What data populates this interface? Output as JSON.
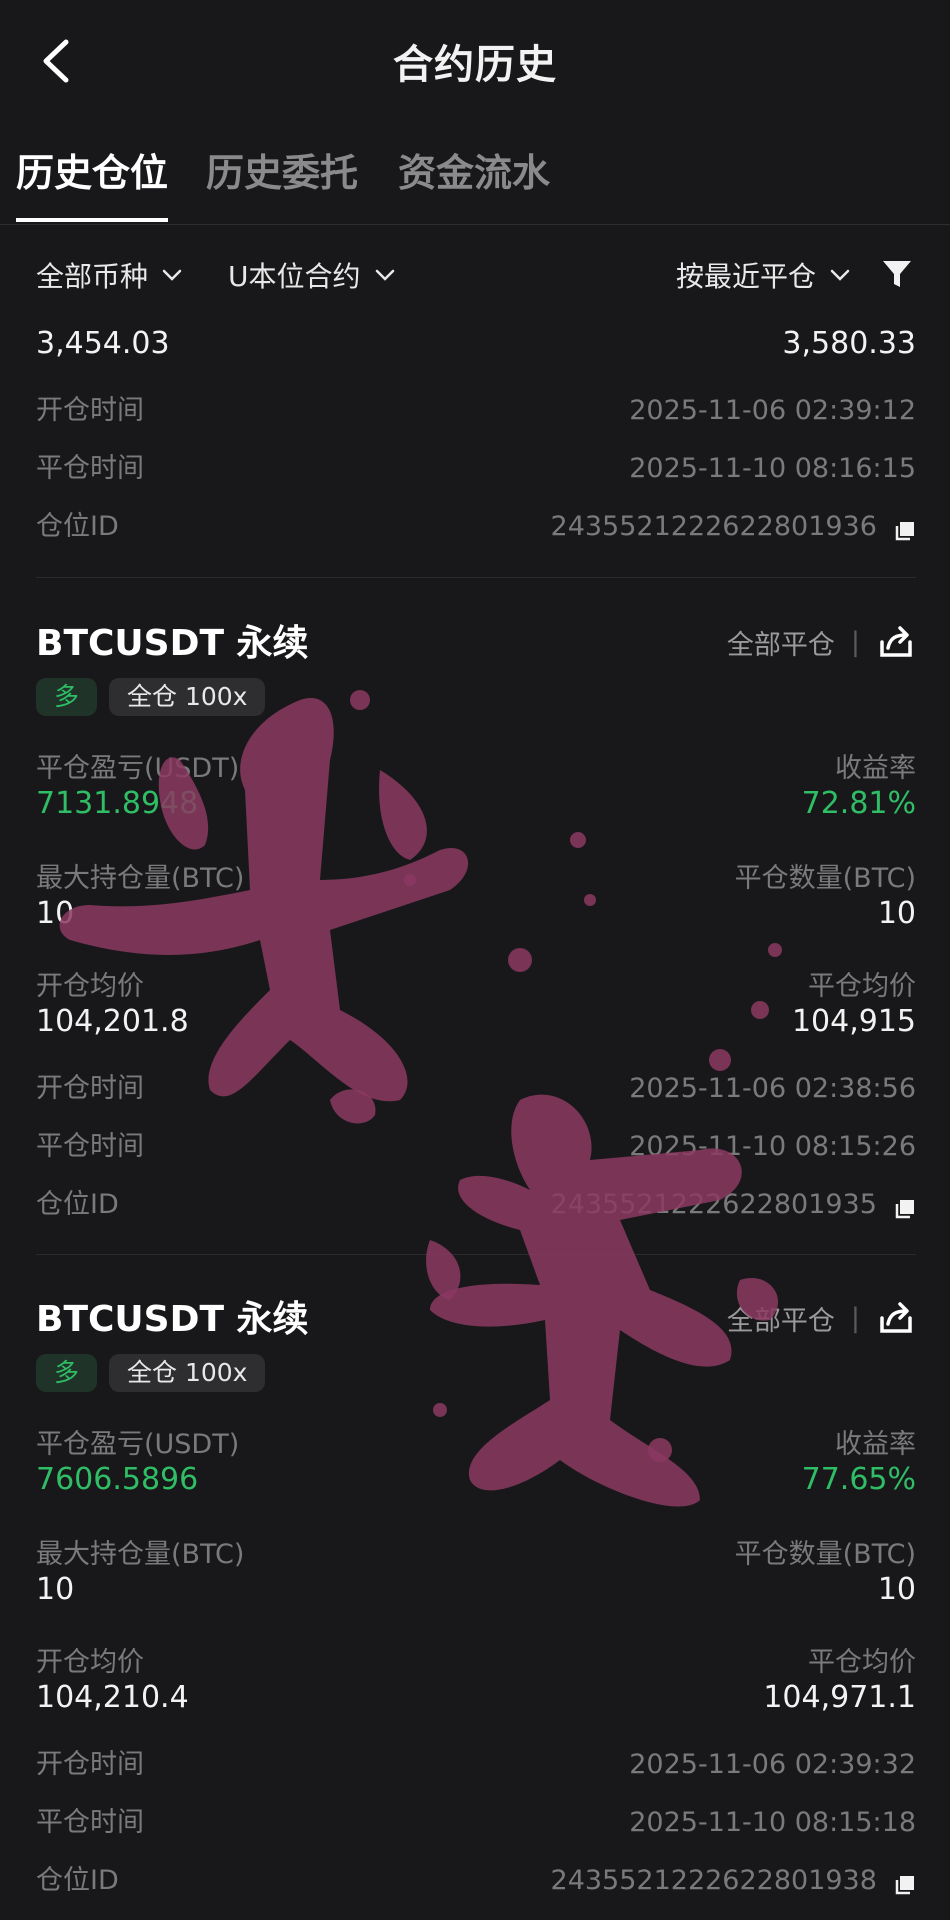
{
  "header": {
    "title": "合约历史",
    "back_icon": "chevron-left-icon"
  },
  "tabs": [
    {
      "label": "历史仓位",
      "active": true
    },
    {
      "label": "历史委托",
      "active": false
    },
    {
      "label": "资金流水",
      "active": false
    }
  ],
  "filters": {
    "coin": "全部币种",
    "contract_type": "U本位合约",
    "sort": "按最近平仓",
    "filter_icon": "funnel-icon"
  },
  "partial_card": {
    "open_avg_price": "3,454.03",
    "close_avg_price": "3,580.33",
    "open_time_label": "开仓时间",
    "open_time": "2025-11-06 02:39:12",
    "close_time_label": "平仓时间",
    "close_time": "2025-11-10 08:16:15",
    "position_id_label": "仓位ID",
    "position_id": "2435521222622801936"
  },
  "cards": [
    {
      "symbol": "BTCUSDT 永续",
      "action_label": "全部平仓",
      "side_tag": "多",
      "margin_tag": "全仓 100x",
      "pnl_label": "平仓盈亏(USDT)",
      "pnl": "7131.8948",
      "roi_label": "收益率",
      "roi": "72.81%",
      "max_pos_label": "最大持仓量(BTC)",
      "max_pos": "10",
      "close_qty_label": "平仓数量(BTC)",
      "close_qty": "10",
      "open_avg_label": "开仓均价",
      "open_avg": "104,201.8",
      "close_avg_label": "平仓均价",
      "close_avg": "104,915",
      "open_time_label": "开仓时间",
      "open_time": "2025-11-06 02:38:56",
      "close_time_label": "平仓时间",
      "close_time": "2025-11-10 08:15:26",
      "position_id_label": "仓位ID",
      "position_id": "2435521222622801935"
    },
    {
      "symbol": "BTCUSDT 永续",
      "action_label": "全部平仓",
      "side_tag": "多",
      "margin_tag": "全仓 100x",
      "pnl_label": "平仓盈亏(USDT)",
      "pnl": "7606.5896",
      "roi_label": "收益率",
      "roi": "77.65%",
      "max_pos_label": "最大持仓量(BTC)",
      "max_pos": "10",
      "close_qty_label": "平仓数量(BTC)",
      "close_qty": "10",
      "open_avg_label": "开仓均价",
      "open_avg": "104,210.4",
      "close_avg_label": "平仓均价",
      "close_avg": "104,971.1",
      "open_time_label": "开仓时间",
      "open_time": "2025-11-06 02:39:32",
      "close_time_label": "平仓时间",
      "close_time": "2025-11-10 08:15:18",
      "position_id_label": "仓位ID",
      "position_id": "2435521222622801938"
    }
  ],
  "colors": {
    "background": "#18181a",
    "profit_green": "#2fbd65",
    "stamp": "#8b3a62"
  }
}
